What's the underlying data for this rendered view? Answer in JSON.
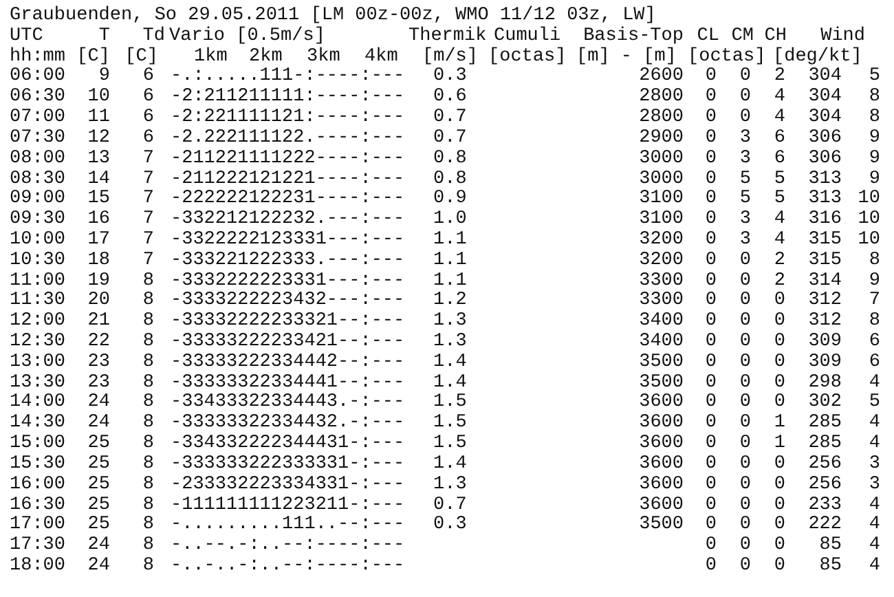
{
  "title": "Graubuenden, So 29.05.2011 [LM 00z-00z, WMO 11/12 03z, LW]",
  "header_rows": [
    [
      "UTC",
      "T",
      "Td",
      "Vario [0.5m/s]",
      "Thermik",
      "Cumuli",
      "Basis-Top",
      "CL",
      "CM",
      "CH",
      "Wind"
    ],
    [
      "hh:mm",
      "[C]",
      "[C]",
      "1km",
      "2km",
      "3km",
      "4km",
      "[m/s]",
      "[octas]",
      "[m] - [m]",
      "[octas]",
      "[deg/kt]"
    ]
  ],
  "rows": [
    {
      "time": "06:00",
      "t": "9",
      "td": "6",
      "vario": "-.:.....111-:----:---",
      "thermik": "0.3",
      "basis": "2600",
      "cl": "0",
      "cm": "0",
      "ch": "2",
      "wind_dir": "304",
      "wind_kt": "5"
    },
    {
      "time": "06:30",
      "t": "10",
      "td": "6",
      "vario": "-2:211211111:----:---",
      "thermik": "0.6",
      "basis": "2800",
      "cl": "0",
      "cm": "0",
      "ch": "4",
      "wind_dir": "304",
      "wind_kt": "8"
    },
    {
      "time": "07:00",
      "t": "11",
      "td": "6",
      "vario": "-2:221111121:----:---",
      "thermik": "0.7",
      "basis": "2800",
      "cl": "0",
      "cm": "0",
      "ch": "4",
      "wind_dir": "304",
      "wind_kt": "8"
    },
    {
      "time": "07:30",
      "t": "12",
      "td": "6",
      "vario": "-2.222111122.----:---",
      "thermik": "0.7",
      "basis": "2900",
      "cl": "0",
      "cm": "3",
      "ch": "6",
      "wind_dir": "306",
      "wind_kt": "9"
    },
    {
      "time": "08:00",
      "t": "13",
      "td": "7",
      "vario": "-211221111222----:---",
      "thermik": "0.8",
      "basis": "3000",
      "cl": "0",
      "cm": "3",
      "ch": "6",
      "wind_dir": "306",
      "wind_kt": "9"
    },
    {
      "time": "08:30",
      "t": "14",
      "td": "7",
      "vario": "-211222121221----:---",
      "thermik": "0.8",
      "basis": "3000",
      "cl": "0",
      "cm": "5",
      "ch": "5",
      "wind_dir": "313",
      "wind_kt": "9"
    },
    {
      "time": "09:00",
      "t": "15",
      "td": "7",
      "vario": "-222222122231----:---",
      "thermik": "0.9",
      "basis": "3100",
      "cl": "0",
      "cm": "5",
      "ch": "5",
      "wind_dir": "313",
      "wind_kt": "10"
    },
    {
      "time": "09:30",
      "t": "16",
      "td": "7",
      "vario": "-332212122232.---:---",
      "thermik": "1.0",
      "basis": "3100",
      "cl": "0",
      "cm": "3",
      "ch": "4",
      "wind_dir": "316",
      "wind_kt": "10"
    },
    {
      "time": "10:00",
      "t": "17",
      "td": "7",
      "vario": "-3322222123331---:---",
      "thermik": "1.1",
      "basis": "3200",
      "cl": "0",
      "cm": "3",
      "ch": "4",
      "wind_dir": "315",
      "wind_kt": "10"
    },
    {
      "time": "10:30",
      "t": "18",
      "td": "7",
      "vario": "-333221222333.---:---",
      "thermik": "1.1",
      "basis": "3200",
      "cl": "0",
      "cm": "0",
      "ch": "2",
      "wind_dir": "315",
      "wind_kt": "8"
    },
    {
      "time": "11:00",
      "t": "19",
      "td": "8",
      "vario": "-3332222223331---:---",
      "thermik": "1.1",
      "basis": "3300",
      "cl": "0",
      "cm": "0",
      "ch": "2",
      "wind_dir": "314",
      "wind_kt": "9"
    },
    {
      "time": "11:30",
      "t": "20",
      "td": "8",
      "vario": "-3333222223432---:---",
      "thermik": "1.2",
      "basis": "3300",
      "cl": "0",
      "cm": "0",
      "ch": "0",
      "wind_dir": "312",
      "wind_kt": "7"
    },
    {
      "time": "12:00",
      "t": "21",
      "td": "8",
      "vario": "-33332222233321--:---",
      "thermik": "1.3",
      "basis": "3400",
      "cl": "0",
      "cm": "0",
      "ch": "0",
      "wind_dir": "312",
      "wind_kt": "8"
    },
    {
      "time": "12:30",
      "t": "22",
      "td": "8",
      "vario": "-33333222233421--:---",
      "thermik": "1.3",
      "basis": "3400",
      "cl": "0",
      "cm": "0",
      "ch": "0",
      "wind_dir": "309",
      "wind_kt": "6"
    },
    {
      "time": "13:00",
      "t": "23",
      "td": "8",
      "vario": "-33333222334442--:---",
      "thermik": "1.4",
      "basis": "3500",
      "cl": "0",
      "cm": "0",
      "ch": "0",
      "wind_dir": "309",
      "wind_kt": "6"
    },
    {
      "time": "13:30",
      "t": "23",
      "td": "8",
      "vario": "-33333322334441--:---",
      "thermik": "1.4",
      "basis": "3500",
      "cl": "0",
      "cm": "0",
      "ch": "0",
      "wind_dir": "298",
      "wind_kt": "4"
    },
    {
      "time": "14:00",
      "t": "24",
      "td": "8",
      "vario": "-33433322334443.-:---",
      "thermik": "1.5",
      "basis": "3600",
      "cl": "0",
      "cm": "0",
      "ch": "0",
      "wind_dir": "302",
      "wind_kt": "5"
    },
    {
      "time": "14:30",
      "t": "24",
      "td": "8",
      "vario": "-33333322334432.-:---",
      "thermik": "1.5",
      "basis": "3600",
      "cl": "0",
      "cm": "0",
      "ch": "1",
      "wind_dir": "285",
      "wind_kt": "4"
    },
    {
      "time": "15:00",
      "t": "25",
      "td": "8",
      "vario": "-334332222344431-:---",
      "thermik": "1.5",
      "basis": "3600",
      "cl": "0",
      "cm": "0",
      "ch": "1",
      "wind_dir": "285",
      "wind_kt": "4"
    },
    {
      "time": "15:30",
      "t": "25",
      "td": "8",
      "vario": "-333333222333331-:---",
      "thermik": "1.4",
      "basis": "3600",
      "cl": "0",
      "cm": "0",
      "ch": "0",
      "wind_dir": "256",
      "wind_kt": "3"
    },
    {
      "time": "16:00",
      "t": "25",
      "td": "8",
      "vario": "-233332223334331-:---",
      "thermik": "1.3",
      "basis": "3600",
      "cl": "0",
      "cm": "0",
      "ch": "0",
      "wind_dir": "256",
      "wind_kt": "3"
    },
    {
      "time": "16:30",
      "t": "25",
      "td": "8",
      "vario": "-111111111223211-:---",
      "thermik": "0.7",
      "basis": "3600",
      "cl": "0",
      "cm": "0",
      "ch": "0",
      "wind_dir": "233",
      "wind_kt": "4"
    },
    {
      "time": "17:00",
      "t": "25",
      "td": "8",
      "vario": "-.........111..--:---",
      "thermik": "0.3",
      "basis": "3500",
      "cl": "0",
      "cm": "0",
      "ch": "0",
      "wind_dir": "222",
      "wind_kt": "4"
    },
    {
      "time": "17:30",
      "t": "24",
      "td": "8",
      "vario": "-..--.-:..--:----:---",
      "cl": "0",
      "cm": "0",
      "ch": "0",
      "wind_dir": "85",
      "wind_kt": "4"
    },
    {
      "time": "18:00",
      "t": "24",
      "td": "8",
      "vario": "-..-..-:..--:----:---",
      "cl": "0",
      "cm": "0",
      "ch": "0",
      "wind_dir": "85",
      "wind_kt": "4"
    }
  ]
}
